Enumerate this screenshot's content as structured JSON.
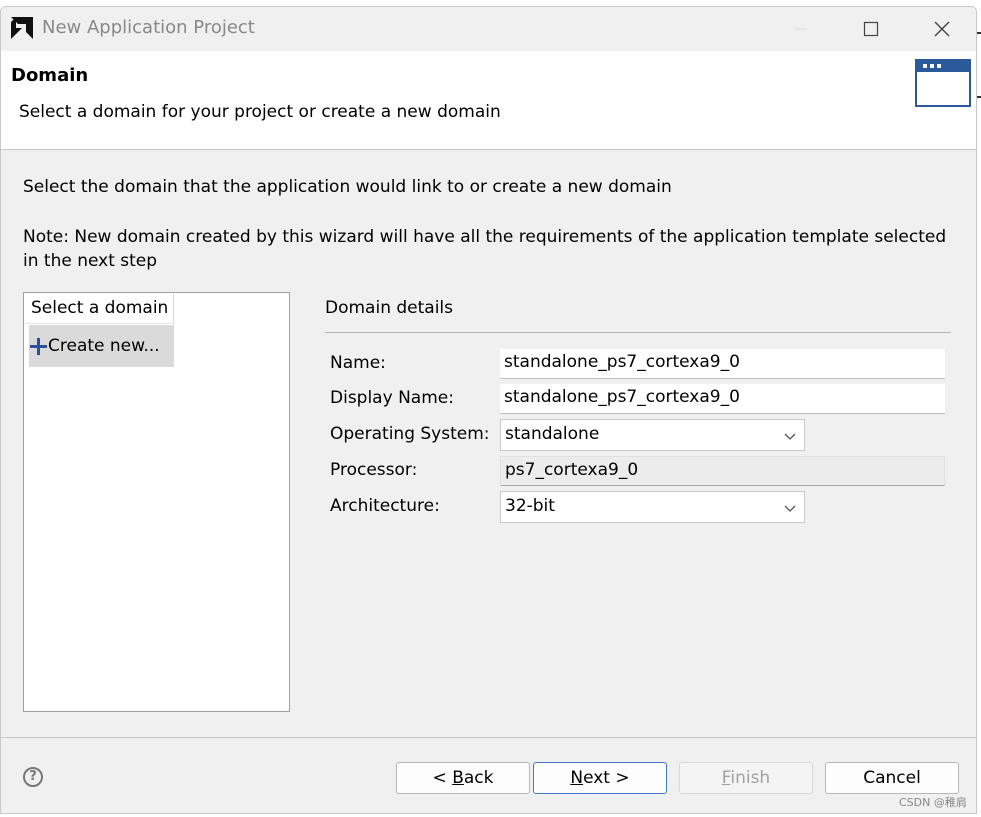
{
  "window": {
    "title": "New Application Project"
  },
  "banner": {
    "title": "Domain",
    "description": "Select a domain for your project or create a new domain",
    "icon": "wizard-window-icon"
  },
  "intro_text": "Select the domain that the application would link to or create a new domain",
  "note_text": "Note: New domain created by this wizard will have all the requirements of the application template selected in the next step",
  "domain_list": {
    "header": "Select a domain",
    "items": [
      {
        "label": "Create new...",
        "icon": "plus-icon",
        "selected": true
      }
    ]
  },
  "details": {
    "title": "Domain details",
    "name_label": "Name:",
    "name_value": "standalone_ps7_cortexa9_0",
    "display_name_label": "Display Name:",
    "display_name_value": "standalone_ps7_cortexa9_0",
    "os_label": "Operating System:",
    "os_value": "standalone",
    "processor_label": "Processor:",
    "processor_value": "ps7_cortexa9_0",
    "architecture_label": "Architecture:",
    "architecture_value": "32-bit"
  },
  "buttons": {
    "back_pre": "< ",
    "back_mnemonic": "B",
    "back_post": "ack",
    "next_mnemonic": "N",
    "next_post": "ext >",
    "finish_mnemonic": "F",
    "finish_post": "inish",
    "cancel": "Cancel"
  },
  "watermark": "CSDN @稚肩",
  "colors": {
    "accent": "#2a4f9c",
    "default_button_border": "#3a78c8",
    "window_bg": "#f0f0f0"
  }
}
